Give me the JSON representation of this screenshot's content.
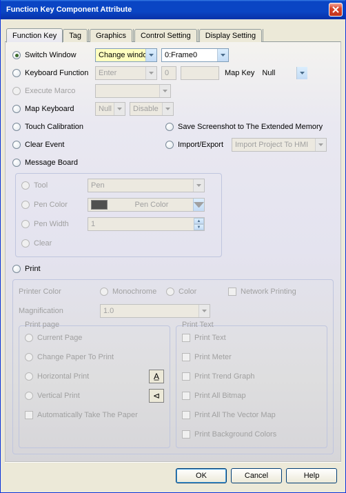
{
  "title": "Function Key Component Attribute",
  "tabs": [
    "Function Key",
    "Tag",
    "Graphics",
    "Control Setting",
    "Display Setting"
  ],
  "switch_window": {
    "label": "Switch Window",
    "type_value": "Change window",
    "frame_value": "0:Frame0"
  },
  "keyboard_function": {
    "label": "Keyboard Function",
    "action_value": "Enter",
    "num_value": "0",
    "map_label": "Map Key",
    "map_value": "Null"
  },
  "execute_macro": {
    "label": "Execute Marco"
  },
  "map_keyboard": {
    "label": "Map Keyboard",
    "v1": "Null",
    "v2": "Disable"
  },
  "touch_calibration": "Touch Calibration",
  "save_screenshot": "Save Screenshot to The Extended Memory",
  "clear_event": "Clear Event",
  "import_export": {
    "label": "Import/Export",
    "value": "Import Project To HMI"
  },
  "message_board": {
    "legend": "Message Board",
    "tool": {
      "label": "Tool",
      "value": "Pen"
    },
    "pen_color": {
      "label": "Pen Color",
      "btn": "Pen Color"
    },
    "pen_width": {
      "label": "Pen Width",
      "value": "1"
    },
    "clear": "Clear"
  },
  "print": {
    "legend": "Print",
    "printer_color": {
      "label": "Printer Color",
      "mono": "Monochrome",
      "color": "Color"
    },
    "network_printing": "Network Printing",
    "magnification": {
      "label": "Magnification",
      "value": "1.0"
    },
    "print_page": {
      "legend": "Print page",
      "current": "Current Page",
      "change": "Change Paper To Print",
      "horizontal": "Horizontal Print",
      "vertical": "Vertical Print",
      "auto": "Automatically Take The Paper",
      "icon_h": "A̲",
      "icon_v": "⊲"
    },
    "print_text": {
      "legend": "Print Text",
      "items": [
        "Print Text",
        "Print Meter",
        "Print Trend Graph",
        "Print All Bitmap",
        "Print All The Vector Map",
        "Print Background Colors"
      ]
    }
  },
  "buttons": {
    "ok": "OK",
    "cancel": "Cancel",
    "help": "Help"
  }
}
